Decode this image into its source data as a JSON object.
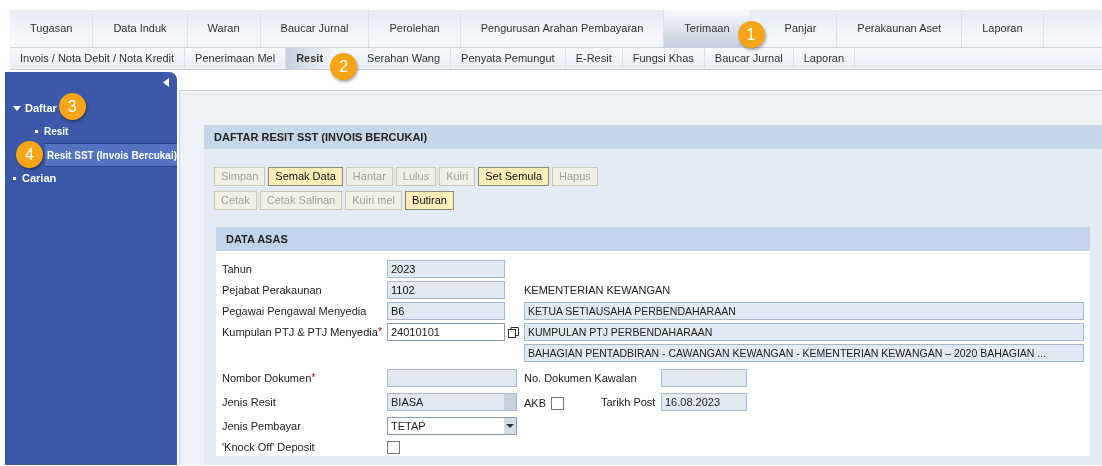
{
  "tabs": [
    {
      "label": "Tugasan",
      "selected": false
    },
    {
      "label": "Data Induk",
      "selected": false
    },
    {
      "label": "Waran",
      "selected": false
    },
    {
      "label": "Baucar Jurnal",
      "selected": false
    },
    {
      "label": "Perolehan",
      "selected": false
    },
    {
      "label": "Pengurusan Arahan Pembayaran",
      "selected": false
    },
    {
      "label": "Terimaan",
      "selected": true,
      "callout": "1"
    },
    {
      "label": "Panjar",
      "selected": false
    },
    {
      "label": "Perakaunan Aset",
      "selected": false
    },
    {
      "label": "Laporan",
      "selected": false
    }
  ],
  "subtabs": [
    {
      "label": "Invois / Nota Debit / Nota Kredit",
      "selected": false
    },
    {
      "label": "Penerimaan Mel",
      "selected": false
    },
    {
      "label": "Resit",
      "selected": true,
      "callout": "2"
    },
    {
      "label": "Serahan Wang",
      "selected": false
    },
    {
      "label": "Penyata Pemungut",
      "selected": false
    },
    {
      "label": "E-Resit",
      "selected": false
    },
    {
      "label": "Fungsi Khas",
      "selected": false
    },
    {
      "label": "Baucar Jurnal",
      "selected": false
    },
    {
      "label": "Laporan",
      "selected": false
    }
  ],
  "sidebar": {
    "items": [
      {
        "label": "Daftar",
        "expanded": true,
        "selected": false,
        "callout": "3",
        "children": [
          {
            "label": "Resit",
            "selected": false
          },
          {
            "label": "Resit SST (Invois Bercukai)",
            "selected": true,
            "callout": "4"
          }
        ]
      },
      {
        "label": "Carian",
        "selected": false
      }
    ]
  },
  "panel": {
    "title": "DAFTAR RESIT SST (INVOIS BERCUKAI)",
    "button_rows": [
      [
        {
          "label": "Simpan",
          "disabled": true
        },
        {
          "label": "Semak Data",
          "disabled": false
        },
        {
          "label": "Hantar",
          "disabled": true
        },
        {
          "label": "Lulus",
          "disabled": true
        },
        {
          "label": "Kuiri",
          "disabled": true
        },
        {
          "label": "Set Semula",
          "disabled": false
        },
        {
          "label": "Hapus",
          "disabled": true
        }
      ],
      [
        {
          "label": "Cetak",
          "disabled": true
        },
        {
          "label": "Cetak Salinan",
          "disabled": true
        },
        {
          "label": "Kuiri mel",
          "disabled": true
        },
        {
          "label": "Butiran",
          "disabled": false
        }
      ]
    ],
    "section": {
      "title": "DATA ASAS",
      "rows": [
        {
          "label": "Tahun",
          "field": {
            "kind": "readonly",
            "value": "2023"
          }
        },
        {
          "label": "Pejabat Perakaunan",
          "field": {
            "kind": "readonly",
            "value": "1102"
          },
          "extras": [
            {
              "kind": "caption",
              "text": "KEMENTERIAN KEWANGAN"
            }
          ]
        },
        {
          "label": "Pegawai Pengawal Menyedia",
          "field": {
            "kind": "readonly",
            "value": "B6"
          },
          "extras": [
            {
              "kind": "wide",
              "value": "KETUA SETIAUSAHA PERBENDAHARAAN"
            }
          ]
        },
        {
          "label": "Kumpulan PTJ & PTJ Menyedia",
          "required_mark": "*",
          "field": {
            "kind": "lookup",
            "value": "24010101"
          },
          "extras": [
            {
              "kind": "wide",
              "value": "KUMPULAN PTJ PERBENDAHARAAN"
            }
          ]
        },
        {
          "extras": [
            {
              "kind": "wide",
              "value": "BAHAGIAN PENTADBIRAN - CAWANGAN KEWANGAN - KEMENTERIAN KEWANGAN – 2020 BAHAGIAN ..."
            }
          ]
        },
        {
          "label": "Nombor Dokumen",
          "required_mark": "*",
          "field": {
            "kind": "readonly-wide"
          },
          "extras": [
            {
              "kind": "label",
              "text": "No. Dokumen Kawalan"
            },
            {
              "kind": "short"
            }
          ]
        },
        {
          "label": "Jenis Resit",
          "field": {
            "kind": "select-readonly",
            "value": "BIASA"
          },
          "extras": [
            {
              "kind": "checkbox",
              "text": "AKB",
              "checked": false
            },
            {
              "kind": "label",
              "text": "Tarikh Post"
            },
            {
              "kind": "short",
              "value": "16.08.2023"
            }
          ]
        },
        {
          "label": "Jenis Pembayar",
          "field": {
            "kind": "dropdown",
            "value": "TETAP"
          }
        },
        {
          "label": "'Knock Off' Deposit",
          "field": {
            "kind": "checkbox",
            "checked": false
          }
        }
      ]
    }
  }
}
